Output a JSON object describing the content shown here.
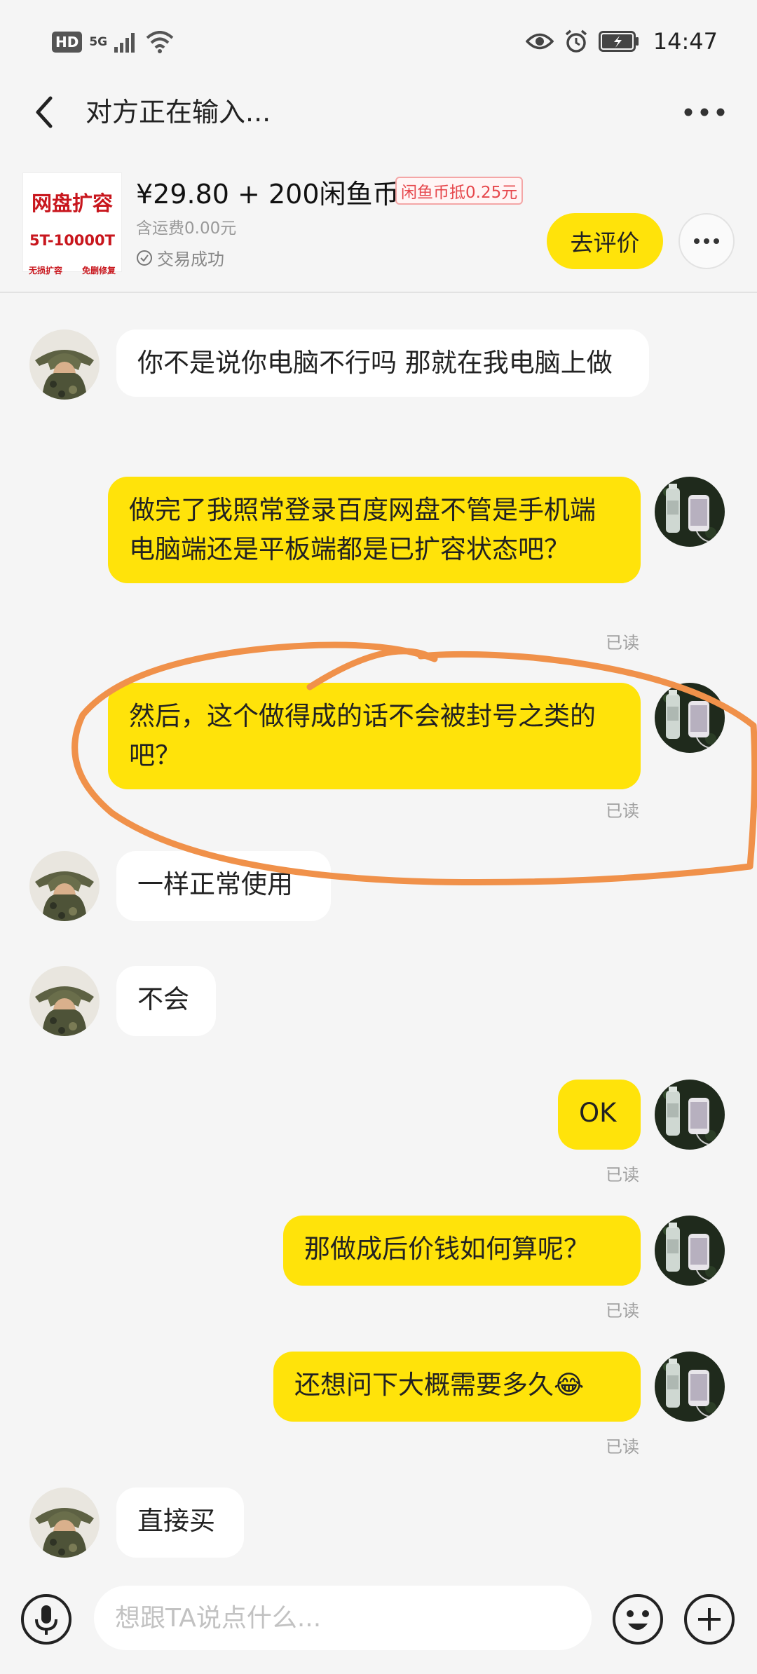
{
  "status_bar": {
    "hd": "HD",
    "network": "5G",
    "time": "14:47"
  },
  "header": {
    "title": "对方正在输入..."
  },
  "product": {
    "image_text": {
      "title": "网盘扩容",
      "spec": "5T-10000T",
      "left_note": "无损扩容",
      "right_note": "免删修复"
    },
    "price": "¥29.80 + 200闲鱼币",
    "coin_tag": "闲鱼币抵0.25元",
    "shipping": "含运费0.00元",
    "status": "交易成功",
    "rate_button": "去评价"
  },
  "messages": [
    {
      "side": "in",
      "text": "你不是说你电脑不行吗 那就在我电脑上做"
    },
    {
      "side": "out",
      "text": "做完了我照常登录百度网盘不管是手机端电脑端还是平板端都是已扩容状态吧？",
      "read": "已读"
    },
    {
      "side": "out",
      "text": "然后，这个做得成的话不会被封号之类的吧？",
      "read": "已读"
    },
    {
      "side": "in",
      "text": "一样正常使用"
    },
    {
      "side": "in",
      "text": "不会"
    },
    {
      "side": "out",
      "text": "OK",
      "read": "已读"
    },
    {
      "side": "out",
      "text": "那做成后价钱如何算呢？",
      "read": "已读"
    },
    {
      "side": "out",
      "text": "还想问下大概需要多久😂",
      "read": "已读"
    },
    {
      "side": "in",
      "text": "直接买"
    }
  ],
  "composer": {
    "placeholder": "想跟TA说点什么..."
  },
  "colors": {
    "accent": "#ffe30a",
    "annotation": "#f0914a",
    "page_bg": "#f5f5f5"
  }
}
